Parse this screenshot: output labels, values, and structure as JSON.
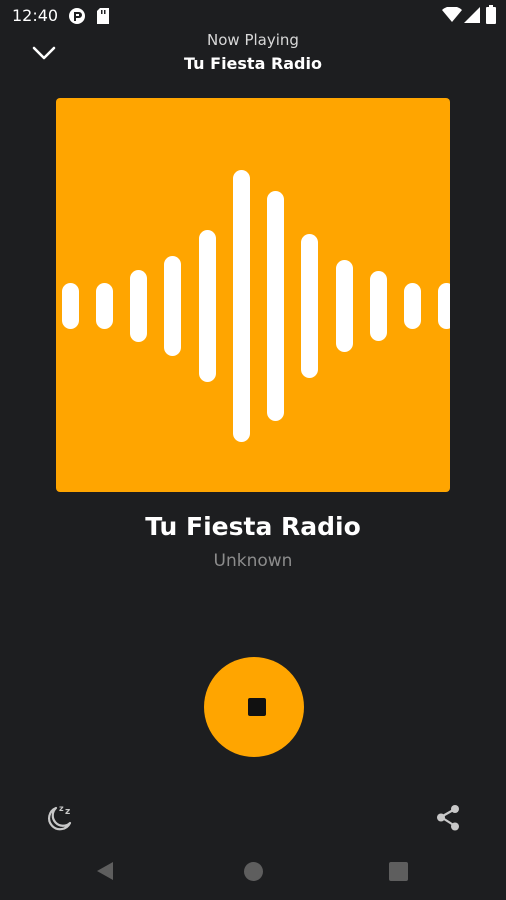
{
  "status_bar": {
    "time": "12:40",
    "icons": [
      "app-notification-icon",
      "sd-card-icon",
      "wifi-icon",
      "cellular-signal-icon",
      "battery-icon"
    ]
  },
  "header": {
    "subtitle": "Now Playing",
    "title": "Tu Fiesta Radio",
    "collapse_icon": "chevron-down-icon"
  },
  "artwork": {
    "background_color": "#ffa500",
    "icon": "waveform-icon"
  },
  "track": {
    "title": "Tu Fiesta Radio",
    "artist": "Unknown"
  },
  "controls": {
    "stop_icon": "stop-icon",
    "sleep_timer_icon": "sleep-timer-icon",
    "share_icon": "share-icon",
    "accent_color": "#ffa500"
  },
  "nav_bar": {
    "icons": [
      "back-icon",
      "home-icon",
      "recents-icon"
    ]
  }
}
